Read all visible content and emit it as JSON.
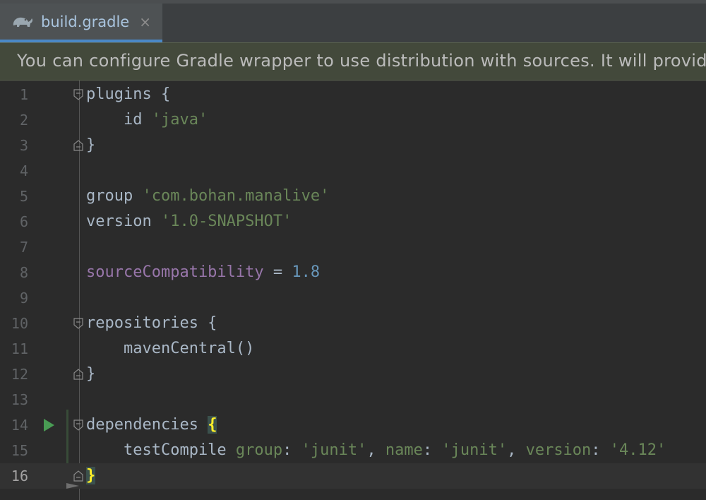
{
  "tab": {
    "label": "build.gradle",
    "close": "×",
    "icon": "gradle-elephant-icon"
  },
  "banner": {
    "text": "You can configure Gradle wrapper to use distribution with sources. It will provide IDE with Gradle API/DSL documentation"
  },
  "editor": {
    "current_line": 16,
    "lines": [
      {
        "n": "1",
        "text": "plugins {"
      },
      {
        "n": "2",
        "text": "    id 'java'"
      },
      {
        "n": "3",
        "text": "}"
      },
      {
        "n": "4",
        "text": ""
      },
      {
        "n": "5",
        "text": "group 'com.bohan.manalive'"
      },
      {
        "n": "6",
        "text": "version '1.0-SNAPSHOT'"
      },
      {
        "n": "7",
        "text": ""
      },
      {
        "n": "8",
        "text": "sourceCompatibility = 1.8"
      },
      {
        "n": "9",
        "text": ""
      },
      {
        "n": "10",
        "text": "repositories {"
      },
      {
        "n": "11",
        "text": "    mavenCentral()"
      },
      {
        "n": "12",
        "text": "}"
      },
      {
        "n": "13",
        "text": ""
      },
      {
        "n": "14",
        "text": "dependencies {"
      },
      {
        "n": "15",
        "text": "    testCompile group: 'junit', name: 'junit', version: '4.12'"
      },
      {
        "n": "16",
        "text": "}"
      }
    ]
  },
  "colors": {
    "background": "#2b2b2b",
    "string": "#6a8759",
    "number": "#6897bb",
    "property": "#9876aa",
    "default_text": "#a9b7c6",
    "brace_highlight": "#ffef28",
    "run_icon": "#499c54"
  }
}
